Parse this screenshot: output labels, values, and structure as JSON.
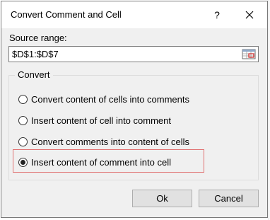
{
  "dialog": {
    "title": "Convert Comment and Cell",
    "help_glyph": "?",
    "close_glyph": "✕"
  },
  "source": {
    "label": "Source range:",
    "value": "$D$1:$D$7"
  },
  "convert": {
    "legend": "Convert",
    "options": [
      {
        "label": "Convert content of cells into comments",
        "selected": false
      },
      {
        "label": "Insert content of cell into comment",
        "selected": false
      },
      {
        "label": "Convert comments into content of cells",
        "selected": false
      },
      {
        "label": "Insert content of comment into cell",
        "selected": true
      }
    ]
  },
  "buttons": {
    "ok": "Ok",
    "cancel": "Cancel"
  },
  "colors": {
    "dialog_bg": "#f0f0f0",
    "highlight": "#e07070",
    "picker_red": "#cc2222"
  }
}
